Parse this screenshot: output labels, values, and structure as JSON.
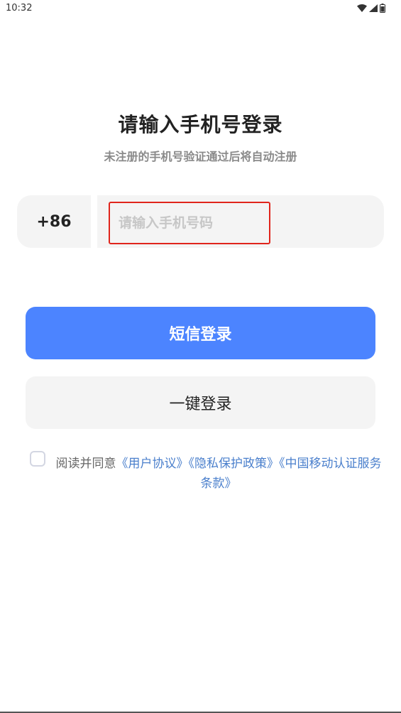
{
  "status_bar": {
    "time": "10:32",
    "icons": [
      "wifi-icon",
      "signal-icon",
      "battery-icon"
    ]
  },
  "title": "请输入手机号登录",
  "subtitle": "未注册的手机号验证通过后将自动注册",
  "phone": {
    "country_code": "+86",
    "placeholder": "请输入手机号码",
    "value": ""
  },
  "buttons": {
    "sms_login": "短信登录",
    "one_click_login": "一键登录"
  },
  "agreement": {
    "checked": false,
    "prefix": "阅读并同意",
    "user_agreement": "《用户协议》",
    "privacy_policy": "《隐私保护政策》",
    "cmcc_terms": "《中国移动认证服务条款》"
  },
  "colors": {
    "primary": "#4c84ff",
    "link": "#4a7fcc",
    "highlight_border": "#e0251c"
  }
}
